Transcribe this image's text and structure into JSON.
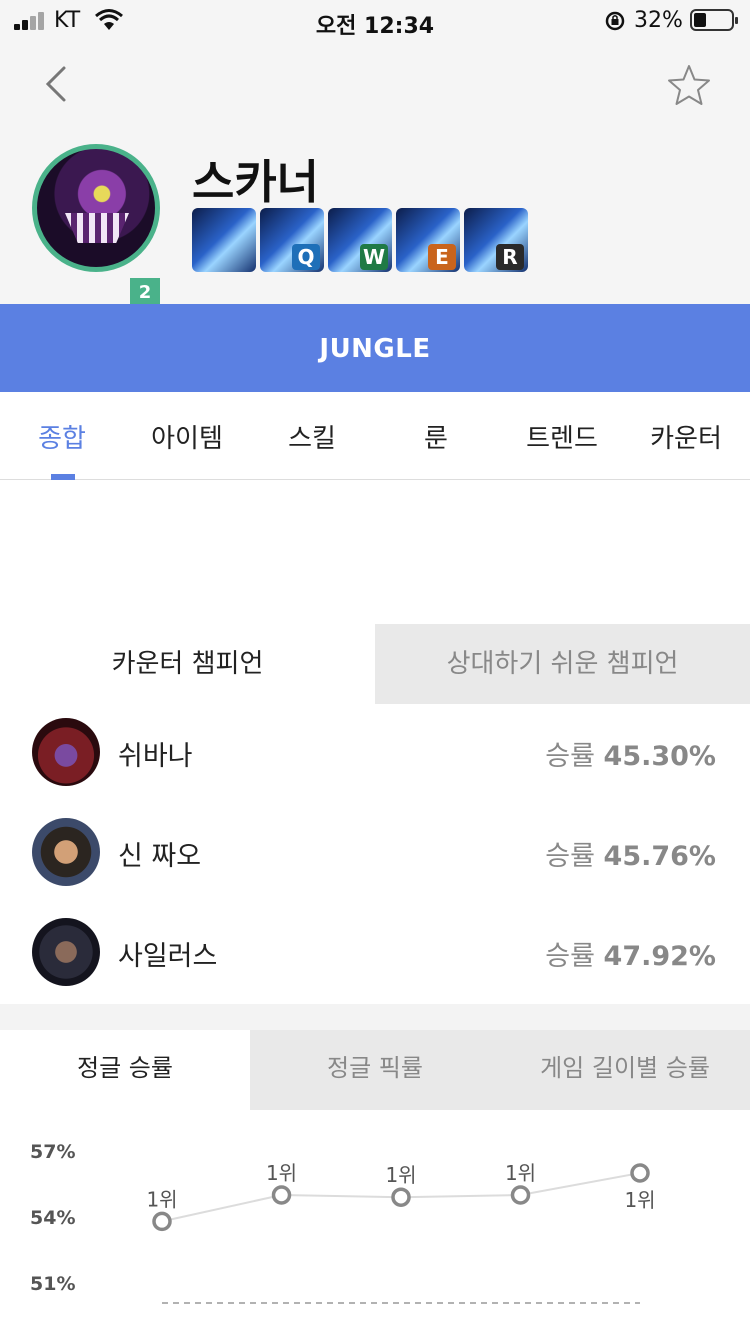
{
  "status_bar": {
    "carrier": "KT",
    "time": "오전 12:34",
    "battery_text": "32%",
    "battery_level": 0.32
  },
  "header": {
    "champion_name": "스카너",
    "level_badge": "2",
    "skills": [
      {
        "key": "",
        "icon": "passive-icon",
        "badge_color": ""
      },
      {
        "key": "Q",
        "icon": "skill-q-icon",
        "badge_color": "#1e6fb8"
      },
      {
        "key": "W",
        "icon": "skill-w-icon",
        "badge_color": "#1f7a45"
      },
      {
        "key": "E",
        "icon": "skill-e-icon",
        "badge_color": "#c9641c"
      },
      {
        "key": "R",
        "icon": "skill-r-icon",
        "badge_color": "#2a2a2a"
      }
    ]
  },
  "role": {
    "label": "JUNGLE",
    "color": "#5b80e2"
  },
  "tabs": [
    {
      "label": "종합",
      "active": true
    },
    {
      "label": "아이템",
      "active": false
    },
    {
      "label": "스킬",
      "active": false
    },
    {
      "label": "룬",
      "active": false
    },
    {
      "label": "트렌드",
      "active": false
    },
    {
      "label": "카운터",
      "active": false
    }
  ],
  "counter": {
    "tab_counter": "카운터 챔피언",
    "tab_easy": "상대하기 쉬운 챔피언",
    "rate_prefix": "승률",
    "items": [
      {
        "name": "쉬바나",
        "rate": "45.30%"
      },
      {
        "name": "신 짜오",
        "rate": "45.76%"
      },
      {
        "name": "사일러스",
        "rate": "47.92%"
      }
    ]
  },
  "bottom_tabs": [
    {
      "label": "정글 승률",
      "active": true
    },
    {
      "label": "정글 픽률",
      "active": false
    },
    {
      "label": "게임 길이별 승률",
      "active": false
    }
  ],
  "chart_data": {
    "type": "line",
    "y_tick_labels": [
      "57%",
      "54%",
      "51%"
    ],
    "ylim": [
      51,
      57
    ],
    "values": [
      53.8,
      55.0,
      54.9,
      55.0,
      56.0
    ],
    "point_labels": [
      "1위",
      "1위",
      "1위",
      "1위",
      "1위"
    ],
    "grid": false
  }
}
